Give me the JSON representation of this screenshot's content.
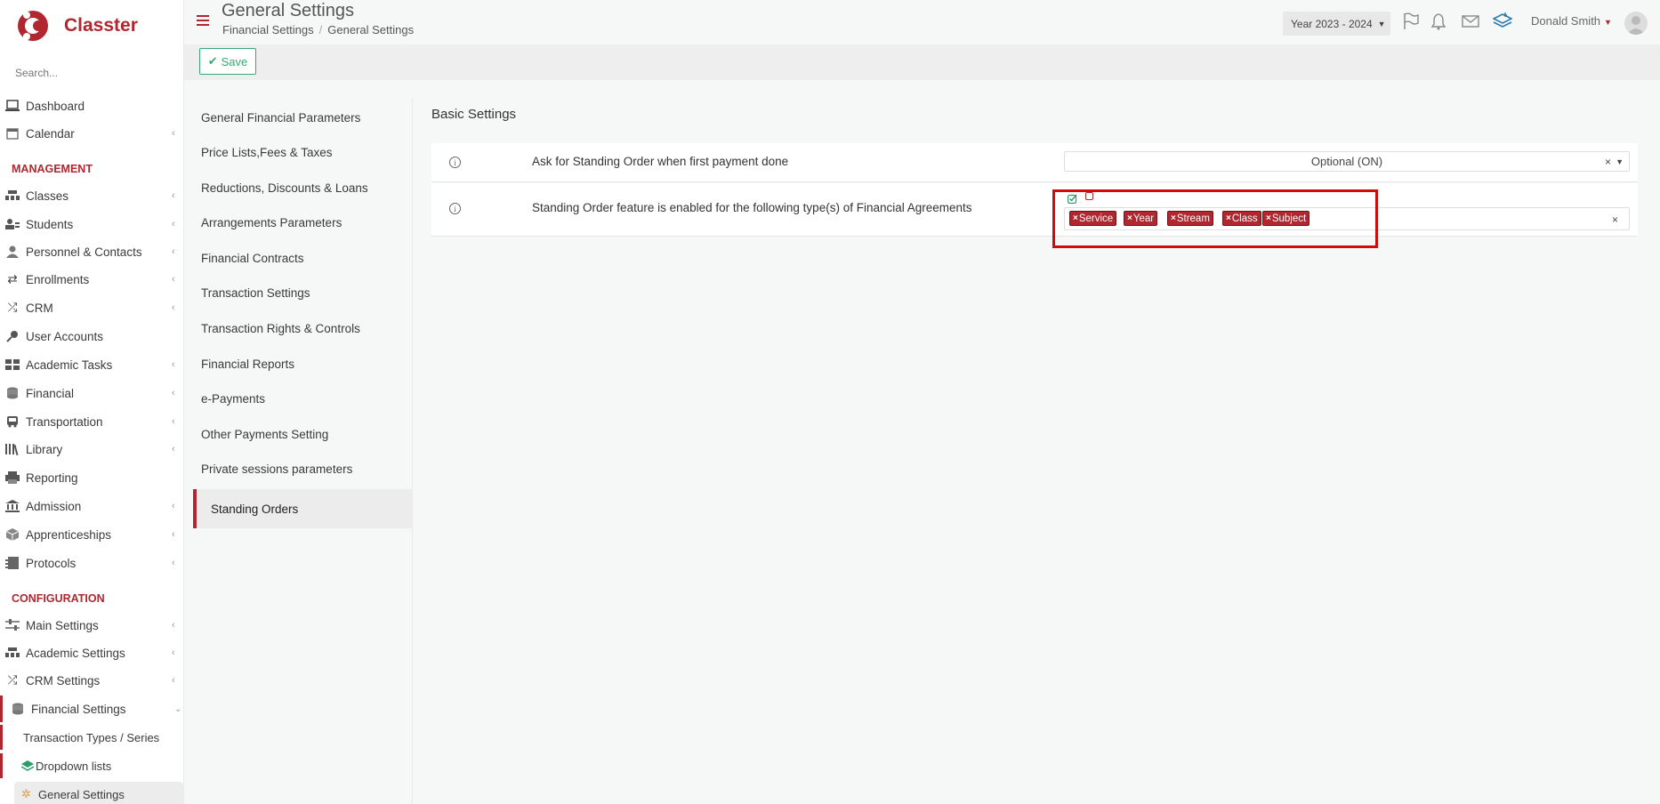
{
  "brand": {
    "name": "Classter",
    "accent": "#b0272f"
  },
  "sidebar": {
    "search_placeholder": "Search...",
    "top_items": [
      {
        "label": "Dashboard",
        "icon": "laptop-icon"
      },
      {
        "label": "Calendar",
        "icon": "calendar-icon"
      }
    ],
    "management_title": "MANAGEMENT",
    "management_items": [
      {
        "label": "Classes",
        "icon": "classes-icon"
      },
      {
        "label": "Students",
        "icon": "students-icon"
      },
      {
        "label": "Personnel & Contacts",
        "icon": "person-icon"
      },
      {
        "label": "Enrollments",
        "icon": "exchange-icon"
      },
      {
        "label": "CRM",
        "icon": "shuffle-icon"
      },
      {
        "label": "User Accounts",
        "icon": "key-icon"
      },
      {
        "label": "Academic Tasks",
        "icon": "grid-icon"
      },
      {
        "label": "Financial",
        "icon": "coins-icon"
      },
      {
        "label": "Transportation",
        "icon": "bus-icon"
      },
      {
        "label": "Library",
        "icon": "books-icon"
      },
      {
        "label": "Reporting",
        "icon": "printer-icon"
      },
      {
        "label": "Admission",
        "icon": "bank-icon"
      },
      {
        "label": "Apprenticeships",
        "icon": "cube-icon"
      },
      {
        "label": "Protocols",
        "icon": "protocol-icon"
      }
    ],
    "configuration_title": "CONFIGURATION",
    "configuration_items": [
      {
        "label": "Main Settings",
        "icon": "sliders-icon"
      },
      {
        "label": "Academic Settings",
        "icon": "classes-icon"
      },
      {
        "label": "CRM Settings",
        "icon": "shuffle-icon"
      },
      {
        "label": "Financial Settings",
        "icon": "coins-icon"
      }
    ],
    "sub_items": [
      {
        "label": "Transaction Types / Series"
      },
      {
        "label": "Dropdown lists",
        "icon": "layers-icon"
      },
      {
        "label": "General Settings",
        "icon": "gear-icon"
      }
    ]
  },
  "header": {
    "title": "General Settings",
    "breadcrumb": [
      "Financial Settings",
      "General Settings"
    ],
    "year": "Year 2023 - 2024",
    "user": "Donald Smith"
  },
  "toolbar": {
    "save_label": "Save"
  },
  "left_menu": {
    "items": [
      "General Financial Parameters",
      "Price Lists,Fees & Taxes",
      "Reductions, Discounts & Loans",
      "Arrangements Parameters",
      "Financial Contracts",
      "Transaction Settings",
      "Transaction Rights & Controls",
      "Financial Reports",
      "e-Payments",
      "Other Payments Setting",
      "Private sessions parameters"
    ],
    "active": "Standing Orders"
  },
  "content": {
    "section_title": "Basic Settings",
    "rows": [
      {
        "label": "Ask for Standing Order when first payment done",
        "value": "Optional (ON)"
      },
      {
        "label": "Standing Order feature is enabled for the following type(s) of Financial Agreements",
        "tags": [
          "Service",
          "Year",
          "Stream",
          "Class",
          "Subject"
        ]
      }
    ]
  }
}
